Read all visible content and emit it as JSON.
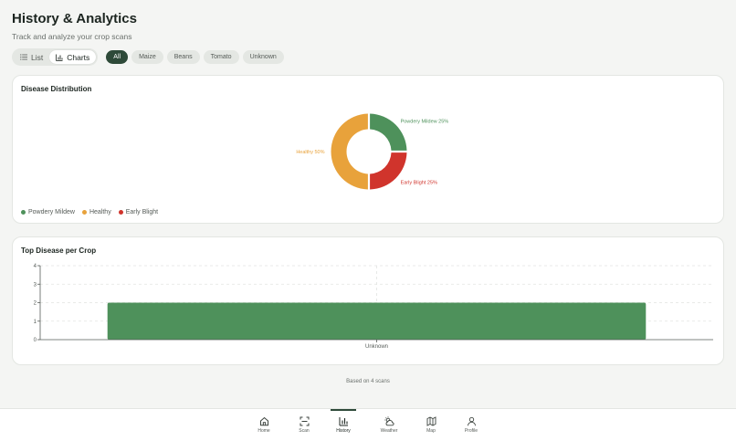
{
  "header": {
    "title": "History & Analytics",
    "subtitle": "Track and analyze your crop scans"
  },
  "view_toggle": {
    "list_label": "List",
    "charts_label": "Charts",
    "active": "charts"
  },
  "filters": [
    {
      "label": "All",
      "active": true
    },
    {
      "label": "Maize",
      "active": false
    },
    {
      "label": "Beans",
      "active": false
    },
    {
      "label": "Tomato",
      "active": false
    },
    {
      "label": "Unknown",
      "active": false
    }
  ],
  "colors": {
    "accent": "#2e4a39",
    "powdery_mildew": "#4e915b",
    "healthy": "#e8a23b",
    "early_blight": "#d0342c"
  },
  "distribution_card": {
    "title": "Disease Distribution",
    "legend": [
      "Powdery Mildew",
      "Healthy",
      "Early Blight"
    ]
  },
  "top_disease_card": {
    "title": "Top Disease per Crop"
  },
  "footnote": "Based on 4 scans",
  "nav": [
    {
      "label": "Home",
      "icon": "home-icon",
      "active": false
    },
    {
      "label": "Scan",
      "icon": "scan-icon",
      "active": false
    },
    {
      "label": "History",
      "icon": "chart-icon",
      "active": true
    },
    {
      "label": "Weather",
      "icon": "weather-icon",
      "active": false
    },
    {
      "label": "Map",
      "icon": "map-icon",
      "active": false
    },
    {
      "label": "Profile",
      "icon": "profile-icon",
      "active": false
    }
  ],
  "chart_data": [
    {
      "type": "pie",
      "title": "Disease Distribution",
      "donut": true,
      "slices": [
        {
          "label": "Powdery Mildew",
          "percent": 25,
          "display": "Powdery Mildew 25%",
          "color": "#4e915b"
        },
        {
          "label": "Early Blight",
          "percent": 25,
          "display": "Early Blight 25%",
          "color": "#d0342c"
        },
        {
          "label": "Healthy",
          "percent": 50,
          "display": "Healthy 50%",
          "color": "#e8a23b"
        }
      ],
      "legend_position": "bottom-left"
    },
    {
      "type": "bar",
      "title": "Top Disease per Crop",
      "categories": [
        "Unknown"
      ],
      "values": [
        2
      ],
      "ylim": [
        0,
        4
      ],
      "yticks": [
        "0",
        "1",
        "2",
        "3",
        "4"
      ],
      "grid": true,
      "bar_color": "#4e915b"
    }
  ]
}
